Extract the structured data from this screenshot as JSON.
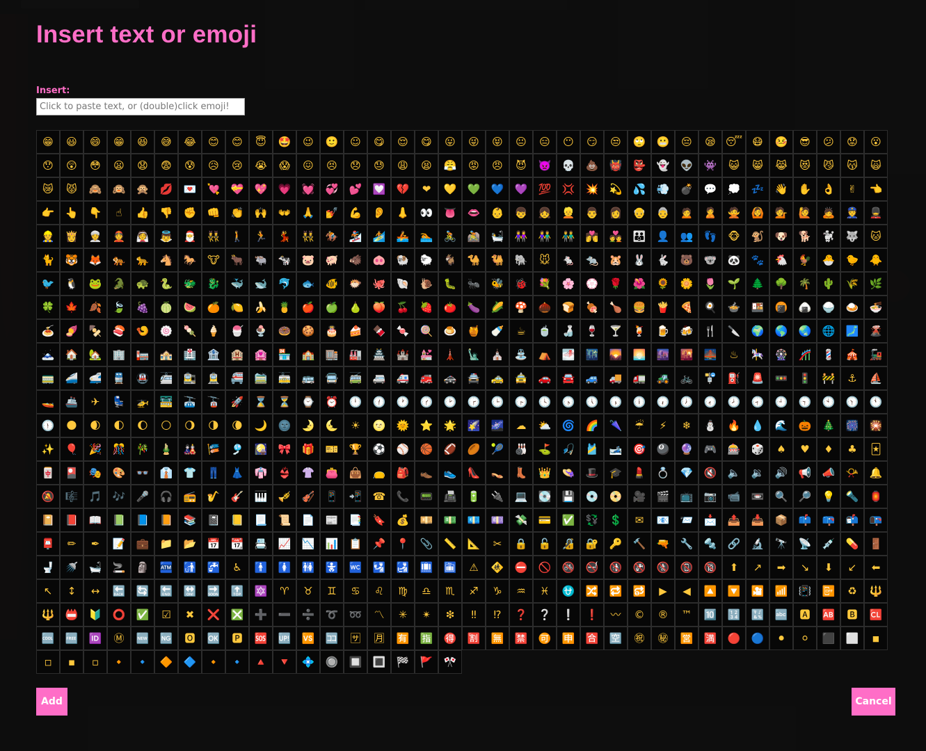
{
  "dialog": {
    "title": "Insert text or emoji",
    "insert_label": "Insert:",
    "input_placeholder": "Click to paste text, or (double)click emoji!",
    "input_value": "",
    "add_label": "Add",
    "cancel_label": "Cancel"
  },
  "colors": {
    "accent": "#ff6ec7",
    "background": "#0c0c0c",
    "cell_border": "#2c2c2c"
  },
  "emojis": [
    "😁",
    "😃",
    "😄",
    "😁",
    "😆",
    "😅",
    "😂",
    "😊",
    "😊",
    "😇",
    "🤩",
    "😉",
    "🙂",
    "☺",
    "😋",
    "😌",
    "😋",
    "😛",
    "😜",
    "😝",
    "😐",
    "😑",
    "😶",
    "😏",
    "😒",
    "🙄",
    "😬",
    "😔",
    "😪",
    "😴",
    "😷",
    "🤒",
    "😎",
    "😕",
    "😟",
    "😮",
    "😯",
    "😲",
    "😳",
    "😦",
    "😧",
    "😨",
    "😰",
    "😥",
    "😢",
    "😭",
    "😱",
    "😖",
    "😣",
    "😞",
    "😓",
    "😩",
    "😫",
    "😤",
    "😡",
    "😠",
    "😈",
    "👿",
    "💀",
    "💩",
    "👹",
    "👺",
    "👻",
    "👽",
    "👾",
    "😺",
    "😸",
    "😹",
    "😻",
    "😼",
    "😽",
    "🙀",
    "😿",
    "😾",
    "🙈",
    "🙉",
    "🙊",
    "💋",
    "💌",
    "💘",
    "💝",
    "💖",
    "💗",
    "💓",
    "💞",
    "💕",
    "💟",
    "💔",
    "❤",
    "💛",
    "💚",
    "💙",
    "💜",
    "💯",
    "💢",
    "💥",
    "💫",
    "💦",
    "💨",
    "💣",
    "💬",
    "💭",
    "💤",
    "👋",
    "✋",
    "👌",
    "✌",
    "👈",
    "👉",
    "👆",
    "👇",
    "☝",
    "👍",
    "👎",
    "✊",
    "👊",
    "👏",
    "🙌",
    "👐",
    "🙏",
    "💅",
    "💪",
    "👂",
    "👃",
    "👀",
    "👅",
    "👄",
    "👶",
    "👦",
    "👧",
    "👱",
    "👨",
    "👩",
    "👴",
    "👵",
    "🙍",
    "🙎",
    "🙅",
    "🙆",
    "💁",
    "🙋",
    "🙇",
    "👮",
    "💂",
    "👷",
    "👸",
    "👳",
    "👲",
    "👰",
    "👼",
    "🎅",
    "👯",
    "🚶",
    "🏃",
    "💃",
    "👯",
    "🏇",
    "🏂",
    "🏄",
    "🚣",
    "🏊",
    "🚴",
    "🚵",
    "🛀",
    "👭",
    "👫",
    "👬",
    "💏",
    "💑",
    "👪",
    "👤",
    "👥",
    "👣",
    "🐵",
    "🐒",
    "🐶",
    "🐕",
    "🐩",
    "🐺",
    "🐱",
    "🐈",
    "🐯",
    "🦊",
    "🐅",
    "🐆",
    "🐴",
    "🐎",
    "🐮",
    "🐂",
    "🐃",
    "🐄",
    "🐷",
    "🐖",
    "🐗",
    "🐽",
    "🐏",
    "🐑",
    "🐐",
    "🐪",
    "🐫",
    "🐘",
    "🐭",
    "🐁",
    "🐀",
    "🐹",
    "🐰",
    "🐇",
    "🐻",
    "🐨",
    "🐼",
    "🐾",
    "🐔",
    "🐓",
    "🐣",
    "🐤",
    "🐥",
    "🐦",
    "🐧",
    "🐸",
    "🐊",
    "🐢",
    "🐍",
    "🐲",
    "🐉",
    "🐳",
    "🐋",
    "🐬",
    "🐟",
    "🐠",
    "🐡",
    "🐙",
    "🐚",
    "🐌",
    "🐛",
    "🐜",
    "🐝",
    "🐞",
    "💐",
    "🌸",
    "💮",
    "🌹",
    "🌺",
    "🌻",
    "🌼",
    "🌷",
    "🌱",
    "🌲",
    "🌳",
    "🌴",
    "🌵",
    "🌾",
    "🌿",
    "🍀",
    "🍁",
    "🍂",
    "🍃",
    "🍇",
    "🍈",
    "🍉",
    "🍊",
    "🍋",
    "🍌",
    "🍍",
    "🍎",
    "🍏",
    "🍐",
    "🍑",
    "🍒",
    "🍓",
    "🍅",
    "🍆",
    "🌽",
    "🍄",
    "🌰",
    "🍞",
    "🍖",
    "🍗",
    "🍔",
    "🍟",
    "🍕",
    "🍳",
    "🍲",
    "🍱",
    "🍘",
    "🍙",
    "🍚",
    "🍛",
    "🍜",
    "🍝",
    "🍠",
    "🍢",
    "🍣",
    "🍤",
    "🍥",
    "🍡",
    "🍦",
    "🍧",
    "🍨",
    "🍩",
    "🍪",
    "🎂",
    "🍰",
    "🍫",
    "🍬",
    "🍭",
    "🍮",
    "🍯",
    "🍼",
    "☕",
    "🍵",
    "🍶",
    "🍷",
    "🍸",
    "🍹",
    "🍺",
    "🍻",
    "🍴",
    "🔪",
    "🌍",
    "🌎",
    "🌏",
    "🌐",
    "🗾",
    "🌋",
    "🗻",
    "🏠",
    "🏡",
    "🏢",
    "🏣",
    "🏤",
    "🏥",
    "🏦",
    "🏨",
    "🏩",
    "🏪",
    "🏫",
    "🏬",
    "🏭",
    "🏯",
    "🏰",
    "💒",
    "🗼",
    "🗽",
    "⛪",
    "⛲",
    "⛺",
    "🌁",
    "🌃",
    "🌄",
    "🌅",
    "🌆",
    "🌇",
    "🌉",
    "♨",
    "🎠",
    "🎡",
    "🎢",
    "💈",
    "🎪",
    "🚂",
    "🚃",
    "🚄",
    "🚅",
    "🚆",
    "🚇",
    "🚈",
    "🚉",
    "🚊",
    "🚝",
    "🚞",
    "🚋",
    "🚌",
    "🚍",
    "🚎",
    "🚐",
    "🚑",
    "🚒",
    "🚓",
    "🚔",
    "🚕",
    "🚖",
    "🚗",
    "🚘",
    "🚙",
    "🚚",
    "🚛",
    "🚜",
    "🚲",
    "🚏",
    "⛽",
    "🚨",
    "🚥",
    "🚦",
    "🚧",
    "⚓",
    "⛵",
    "🚤",
    "🚢",
    "✈",
    "💺",
    "🚁",
    "🚟",
    "🚠",
    "🚡",
    "🚀",
    "⌛",
    "⏳",
    "⌚",
    "⏰",
    "🕛",
    "🕧",
    "🕐",
    "🕜",
    "🕑",
    "🕝",
    "🕒",
    "🕞",
    "🕓",
    "🕟",
    "🕔",
    "🕠",
    "🕕",
    "🕡",
    "🕖",
    "🕢",
    "🕗",
    "🕣",
    "🕘",
    "🕤",
    "🕙",
    "🕥",
    "🕚",
    "🕦",
    "🌑",
    "🌒",
    "🌓",
    "🌔",
    "🌕",
    "🌖",
    "🌗",
    "🌘",
    "🌙",
    "🌚",
    "🌛",
    "🌜",
    "☀",
    "🌝",
    "🌞",
    "⭐",
    "🌟",
    "🌠",
    "🌌",
    "☁",
    "⛅",
    "🌀",
    "🌈",
    "🌂",
    "☔",
    "⚡",
    "❄",
    "⛄",
    "🔥",
    "💧",
    "🌊",
    "🎃",
    "🎄",
    "🎆",
    "🎇",
    "✨",
    "🎈",
    "🎉",
    "🎊",
    "🎋",
    "🎍",
    "🎎",
    "🎏",
    "🎐",
    "🎑",
    "🎀",
    "🎁",
    "🎫",
    "🏆",
    "⚽",
    "⚾",
    "🏀",
    "🏈",
    "🏉",
    "🎾",
    "🎳",
    "⛳",
    "🎣",
    "🎽",
    "🎿",
    "🎯",
    "🎱",
    "🔮",
    "🎮",
    "🎰",
    "🎲",
    "♠",
    "♥",
    "♦",
    "♣",
    "🃏",
    "🀄",
    "🎴",
    "🎭",
    "🎨",
    "👓",
    "👔",
    "👕",
    "👖",
    "👗",
    "👘",
    "👙",
    "👚",
    "👛",
    "👜",
    "👝",
    "🎒",
    "👞",
    "👟",
    "👠",
    "👡",
    "👢",
    "👑",
    "👒",
    "🎩",
    "🎓",
    "💄",
    "💍",
    "💎",
    "🔇",
    "🔈",
    "🔉",
    "🔊",
    "📢",
    "📣",
    "📯",
    "🔔",
    "🔕",
    "🎼",
    "🎵",
    "🎶",
    "🎤",
    "🎧",
    "📻",
    "🎷",
    "🎸",
    "🎹",
    "🎺",
    "🎻",
    "📱",
    "📲",
    "☎",
    "📞",
    "📟",
    "📠",
    "🔋",
    "🔌",
    "💻",
    "💽",
    "💾",
    "💿",
    "📀",
    "🎥",
    "🎬",
    "📺",
    "📷",
    "📹",
    "📼",
    "🔍",
    "🔎",
    "💡",
    "🔦",
    "🏮",
    "📔",
    "📕",
    "📖",
    "📗",
    "📘",
    "📙",
    "📚",
    "📓",
    "📒",
    "📃",
    "📜",
    "📄",
    "📰",
    "📑",
    "🔖",
    "💰",
    "💴",
    "💵",
    "💶",
    "💷",
    "💸",
    "💳",
    "✅",
    "💱",
    "💲",
    "✉",
    "📧",
    "📨",
    "📩",
    "📤",
    "📥",
    "📦",
    "📫",
    "📪",
    "📬",
    "📭",
    "📮",
    "✏",
    "✒",
    "📝",
    "💼",
    "📁",
    "📂",
    "📅",
    "📆",
    "📇",
    "📈",
    "📉",
    "📊",
    "📋",
    "📌",
    "📍",
    "📎",
    "📏",
    "📐",
    "✂",
    "🔒",
    "🔓",
    "🔏",
    "🔐",
    "🔑",
    "🔨",
    "🔫",
    "🔧",
    "🔩",
    "🔗",
    "🔬",
    "🔭",
    "📡",
    "💉",
    "💊",
    "🚪",
    "🚽",
    "🚿",
    "🛁",
    "🚬",
    "🗿",
    "🏧",
    "🚮",
    "🚰",
    "♿",
    "🚹",
    "🚺",
    "🚻",
    "🚼",
    "🚾",
    "🛂",
    "🛃",
    "🛄",
    "🛅",
    "⚠",
    "🚸",
    "⛔",
    "🚫",
    "🚳",
    "🚭",
    "🚯",
    "🚱",
    "🚷",
    "📵",
    "🔞",
    "⬆",
    "↗",
    "➡",
    "↘",
    "⬇",
    "↙",
    "⬅",
    "↖",
    "↕",
    "↔",
    "🔙",
    "🔄",
    "🔚",
    "🔛",
    "🔜",
    "🔝",
    "🔯",
    "♈",
    "♉",
    "♊",
    "♋",
    "♌",
    "♍",
    "♎",
    "♏",
    "♐",
    "♑",
    "♒",
    "♓",
    "⛎",
    "🔀",
    "🔁",
    "🔂",
    "▶",
    "◀",
    "🔼",
    "🔽",
    "🎦",
    "📶",
    "📳",
    "📴",
    "♻",
    "🔱",
    "🔱",
    "📛",
    "🔰",
    "⭕",
    "✅",
    "☑",
    "✖",
    "❌",
    "❎",
    "➕",
    "➖",
    "➗",
    "➰",
    "➿",
    "〽",
    "✳",
    "✴",
    "❇",
    "‼",
    "⁉",
    "❓",
    "❔",
    "❕",
    "❗",
    "〰",
    "©",
    "®",
    "™",
    "🔟",
    "🔢",
    "🔣",
    "🔤",
    "🅰",
    "🆎",
    "🅱",
    "🆑",
    "🆒",
    "🆓",
    "🆔",
    "Ⓜ",
    "🆕",
    "🆖",
    "🅾",
    "🆗",
    "🅿",
    "🆘",
    "🆙",
    "🆚",
    "🈁",
    "🈂",
    "🈷",
    "🈶",
    "🈯",
    "🉐",
    "🈹",
    "🈚",
    "🈲",
    "🉑",
    "🈸",
    "🈴",
    "🈳",
    "㊗",
    "㊙",
    "🈺",
    "🈵",
    "🔴",
    "🔵",
    "⚫",
    "⚪",
    "⬛",
    "⬜",
    "◾",
    "◽",
    "▪",
    "▫",
    "🔸",
    "🔹",
    "🔶",
    "🔷",
    "🔸",
    "🔹",
    "🔺",
    "🔻",
    "💠",
    "🔘",
    "🔲",
    "🔳",
    "🏁",
    "🚩",
    "🎌"
  ]
}
